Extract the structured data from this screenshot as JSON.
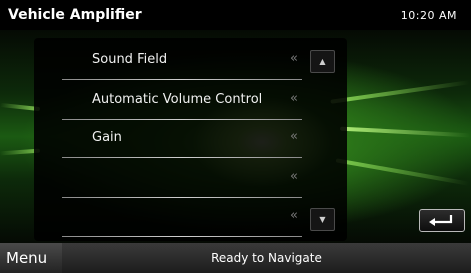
{
  "header": {
    "title": "Vehicle Amplifier",
    "time": "10:20 AM"
  },
  "list": {
    "items": [
      {
        "label": "Sound Field",
        "chevron": "«"
      },
      {
        "label": "Automatic Volume Control",
        "chevron": "«"
      },
      {
        "label": "Gain",
        "chevron": "«"
      },
      {
        "label": "",
        "chevron": "«"
      },
      {
        "label": "",
        "chevron": "«"
      }
    ],
    "scroll_up_symbol": "▲",
    "scroll_down_symbol": "▼"
  },
  "back_button": {
    "icon": "return-arrow-icon"
  },
  "statusbar": {
    "menu_label": "Menu",
    "status_text": "Ready to Navigate"
  },
  "colors": {
    "background_glow": "#8fe060",
    "panel": "#000000",
    "text": "#ffffff"
  }
}
